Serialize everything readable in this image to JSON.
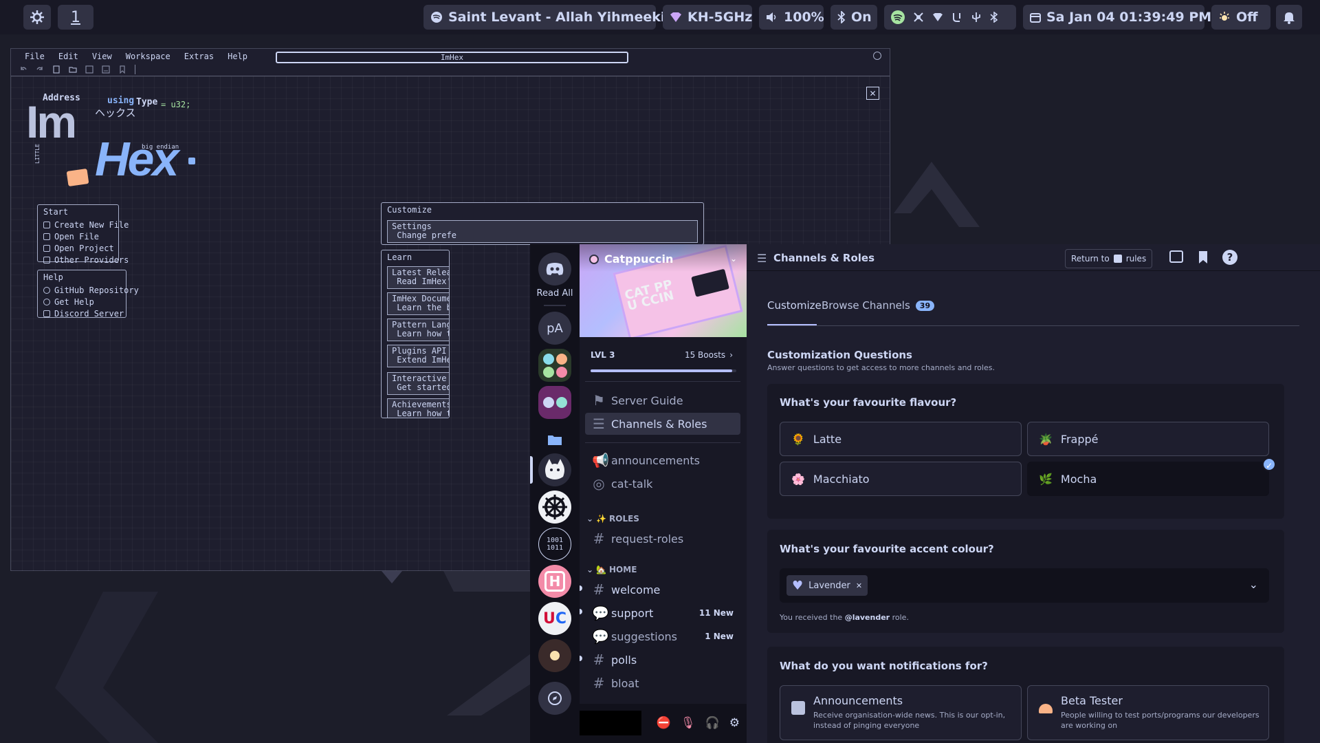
{
  "topbar": {
    "workspace": "1",
    "media": "Saint Levant - Allah Yihmeeki",
    "wifi": "KH-5GHz",
    "volume": "100%",
    "bluetooth": "On",
    "datetime": "Sa Jan 04  01:39:49 PM",
    "nightlight": "Off"
  },
  "imhex": {
    "menu": [
      "File",
      "Edit",
      "View",
      "Workspace",
      "Extras",
      "Help"
    ],
    "search": "ImHex",
    "logo": {
      "word1": "Im",
      "word2": "Hex",
      "address": "Address",
      "using": "using",
      "type": "Type",
      "u32": "= u32;",
      "kana": "ヘックス",
      "be": "big endian",
      "le": "LITTLE"
    },
    "start": {
      "title": "Start",
      "items": [
        "Create New File",
        "Open File",
        "Open Project",
        "Other Providers"
      ]
    },
    "help": {
      "title": "Help",
      "items": [
        "GitHub Repository",
        "Get Help",
        "Discord Server"
      ]
    },
    "customize": {
      "title": "Customize",
      "settings_line1": "Settings",
      "settings_line2": " Change prefe"
    },
    "learn": {
      "title": "Learn",
      "items": [
        {
          "l1": "Latest Releas",
          "l2": " Read ImHex's"
        },
        {
          "l1": "ImHex Documen",
          "l2": " Learn the ba"
        },
        {
          "l1": "Pattern Langu",
          "l2": " Learn how to"
        },
        {
          "l1": "Plugins API",
          "l2": " Extend ImHex"
        },
        {
          "l1": "Interactive T",
          "l2": " Get started"
        },
        {
          "l1": "Achievements",
          "l2": " Learn how to"
        }
      ]
    }
  },
  "discord": {
    "read_all": "Read All",
    "guild_pa": "pA",
    "server_name": "Catppuccin",
    "banner_text": "CAT PPU CCIN",
    "level": "LVL 3",
    "boosts": "15 Boosts",
    "level_progress": 0.97,
    "nav": [
      {
        "label": "Server Guide"
      },
      {
        "label": "Channels & Roles"
      }
    ],
    "channels": [
      "announcements",
      "cat-talk"
    ],
    "roles_cat": "ROLES",
    "roles_channels": [
      "request-roles"
    ],
    "home_cat": "HOME",
    "home_channels": [
      {
        "name": "welcome",
        "badge": ""
      },
      {
        "name": "support",
        "badge": "11 New"
      },
      {
        "name": "suggestions",
        "badge": "1 New"
      },
      {
        "name": "polls",
        "badge": ""
      },
      {
        "name": "bloat",
        "badge": ""
      }
    ],
    "header": {
      "title": "Channels & Roles",
      "return_label": "Return to",
      "return_channel": "rules"
    },
    "tabs": {
      "customize": "Customize",
      "browse": "Browse Channels",
      "browse_count": "39"
    },
    "cq_title": "Customization Questions",
    "cq_sub": "Answer questions to get access to more channels and roles.",
    "q1": {
      "title": "What's your favourite flavour?",
      "options": [
        "Latte",
        "Frappé",
        "Macchiato",
        "Mocha"
      ],
      "selected": "Mocha"
    },
    "q2": {
      "title": "What's your favourite accent colour?",
      "selected": "Lavender",
      "note_pre": "You received the ",
      "note_role": "@lavender",
      "note_post": " role."
    },
    "q3": {
      "title": "What do you want notifications for?",
      "options": [
        {
          "label": "Announcements",
          "desc": "Receive organisation-wide news. This is our opt-in, instead of pinging everyone"
        },
        {
          "label": "Beta Tester",
          "desc": "People willing to test ports/programs our developers are working on"
        }
      ]
    }
  },
  "colors": {
    "accent": "#b4befe",
    "green": "#a6e3a1",
    "bg": "#1e1e2e"
  }
}
